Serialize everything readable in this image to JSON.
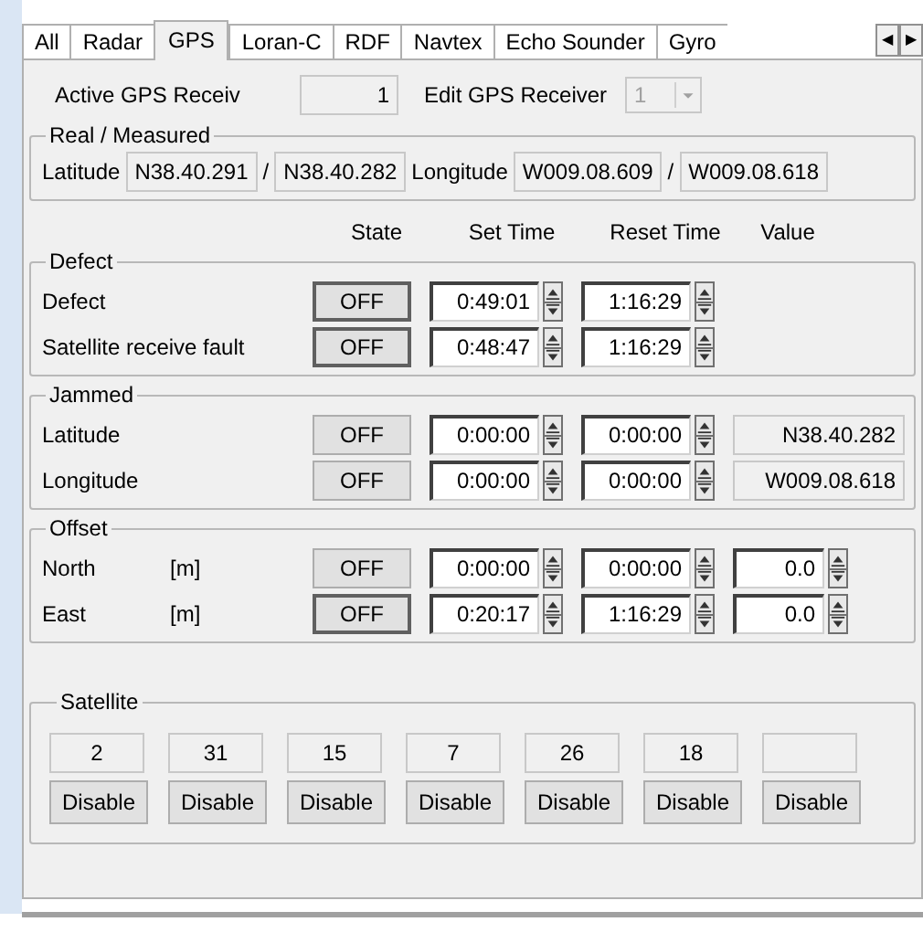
{
  "tabs": [
    {
      "label": "All",
      "selected": false
    },
    {
      "label": "Radar",
      "selected": false
    },
    {
      "label": "GPS",
      "selected": true
    },
    {
      "label": "Loran-C",
      "selected": false
    },
    {
      "label": "RDF",
      "selected": false
    },
    {
      "label": "Navtex",
      "selected": false
    },
    {
      "label": "Echo Sounder",
      "selected": false
    },
    {
      "label": "Gyro",
      "selected": false
    }
  ],
  "tab_scroll": {
    "left": "◀",
    "right": "▶"
  },
  "receiver": {
    "active_label": "Active GPS Receiv",
    "active_value": "1",
    "edit_label": "Edit GPS Receiver",
    "edit_value": "1",
    "edit_disabled": true
  },
  "real_measured": {
    "title": "Real / Measured",
    "latitude_label": "Latitude",
    "latitude_real": "N38.40.291",
    "latitude_measured": "N38.40.282",
    "longitude_label": "Longitude",
    "longitude_real": "W009.08.609",
    "longitude_measured": "W009.08.618",
    "separators": [
      "/",
      "/"
    ]
  },
  "columns": [
    "State",
    "Set Time",
    "Reset Time",
    "Value"
  ],
  "groups": [
    {
      "title": "Defect",
      "rows": [
        {
          "label": "Defect",
          "state": "OFF",
          "focused": true,
          "set_time": "0:49:01",
          "reset_time": "1:16:29"
        },
        {
          "label": "Satellite receive fault",
          "state": "OFF",
          "focused": true,
          "set_time": "0:48:47",
          "reset_time": "1:16:29"
        }
      ]
    },
    {
      "title": "Jammed",
      "rows": [
        {
          "label": "Latitude",
          "state": "OFF",
          "focused": false,
          "set_time": "0:00:00",
          "reset_time": "0:00:00",
          "value": {
            "kind": "readout",
            "text": "N38.40.282"
          }
        },
        {
          "label": "Longitude",
          "state": "OFF",
          "focused": false,
          "set_time": "0:00:00",
          "reset_time": "0:00:00",
          "value": {
            "kind": "readout",
            "text": "W009.08.618"
          }
        }
      ]
    },
    {
      "title": "Offset",
      "rows": [
        {
          "label": "North",
          "unit": "[m]",
          "state": "OFF",
          "focused": false,
          "set_time": "0:00:00",
          "reset_time": "0:00:00",
          "value": {
            "kind": "spin",
            "text": "0.0"
          }
        },
        {
          "label": "East",
          "unit": "[m]",
          "state": "OFF",
          "focused": true,
          "set_time": "0:20:17",
          "reset_time": "1:16:29",
          "value": {
            "kind": "spin",
            "text": "0.0"
          }
        }
      ]
    }
  ],
  "satellite": {
    "title": "Satellite",
    "slots": [
      {
        "number": "2",
        "button": "Disable"
      },
      {
        "number": "31",
        "button": "Disable"
      },
      {
        "number": "15",
        "button": "Disable"
      },
      {
        "number": "7",
        "button": "Disable"
      },
      {
        "number": "26",
        "button": "Disable"
      },
      {
        "number": "18",
        "button": "Disable"
      },
      {
        "button": "Disable"
      }
    ]
  }
}
